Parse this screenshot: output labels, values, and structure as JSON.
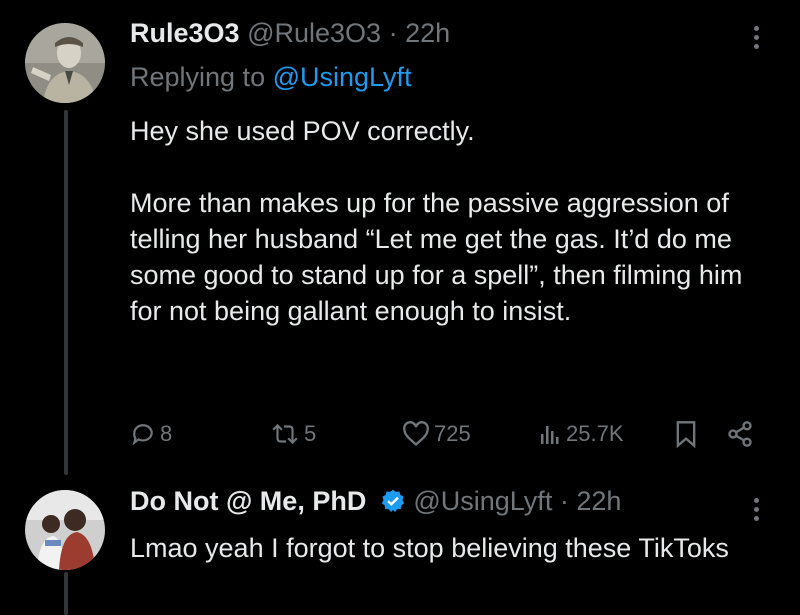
{
  "tweets": [
    {
      "display_name": "Rule3O3",
      "handle": "@Rule3O3",
      "separator": "·",
      "time": "22h",
      "replying_label": "Replying to",
      "replying_handle": "@UsingLyft",
      "paragraphs": [
        "Hey she used POV correctly.",
        "More than makes up for the passive aggression of telling her husband “Let me get the gas. It’d do me some good to stand up for a spell”, then filming him for not being gallant enough to insist."
      ],
      "stats": {
        "replies": "8",
        "reposts": "5",
        "likes": "725",
        "views": "25.7K"
      }
    },
    {
      "display_name": "Do Not @ Me, PhD",
      "handle": "@UsingLyft",
      "separator": "·",
      "time": "22h",
      "verified": true,
      "paragraphs": [
        "Lmao yeah I forgot to stop believing these TikToks"
      ]
    }
  ],
  "icons": {
    "reply": "comment-icon",
    "repost": "repost-icon",
    "like": "heart-icon",
    "views": "views-bar-icon",
    "bookmark": "bookmark-icon",
    "share": "share-icon",
    "more": "more-vertical-icon",
    "verified": "verified-badge-icon"
  },
  "colors": {
    "background": "#000000",
    "text": "#e7e9ea",
    "muted": "#71767b",
    "link": "#1d9bf0",
    "thread_line": "#333639"
  }
}
